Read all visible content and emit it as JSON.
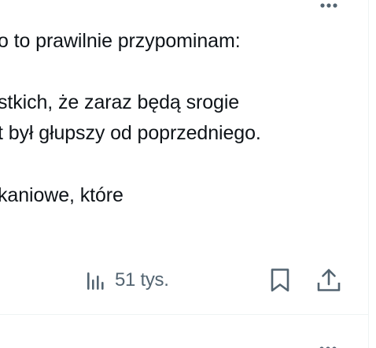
{
  "tweet": {
    "lines": [
      "o to prawilnie przypominam:",
      "",
      "stkich, że zaraz będą srogie",
      "t był głupszy od poprzedniego.",
      "",
      "kaniowe, które"
    ]
  },
  "actions": {
    "views_count": "51 tys.",
    "views_icon": "analytics-icon",
    "bookmark_icon": "bookmark-icon",
    "share_icon": "share-icon"
  },
  "colors": {
    "text": "#0f1419",
    "secondary": "#536471",
    "border": "#eff3f4"
  }
}
